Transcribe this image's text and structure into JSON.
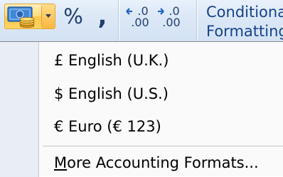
{
  "ribbon": {
    "accounting_button": {
      "icon": "currency-coins-icon"
    },
    "percent_label": "%",
    "comma_label": ",",
    "increase_decimal": {
      "top": "←.0",
      "bottom": ".00",
      "icon": "increase-decimal-icon"
    },
    "decrease_decimal": {
      "top": "→.0",
      "bottom": ".00",
      "icon": "decrease-decimal-icon"
    },
    "conditional_formatting": {
      "line1": "Conditiona",
      "line2": "Formatting"
    }
  },
  "menu": {
    "items": [
      {
        "label": "£ English (U.K.)"
      },
      {
        "label": "$ English (U.S.)"
      },
      {
        "label": "€ Euro (€ 123)"
      }
    ],
    "more": {
      "access_key": "M",
      "rest": "ore Accounting Formats..."
    }
  },
  "colors": {
    "ribbon_bg": "#dce8f6",
    "hover_gold": "#ffd566",
    "ribbon_text": "#15428b",
    "menu_bg": "#fafafa",
    "menu_gutter": "#e9eef6"
  }
}
